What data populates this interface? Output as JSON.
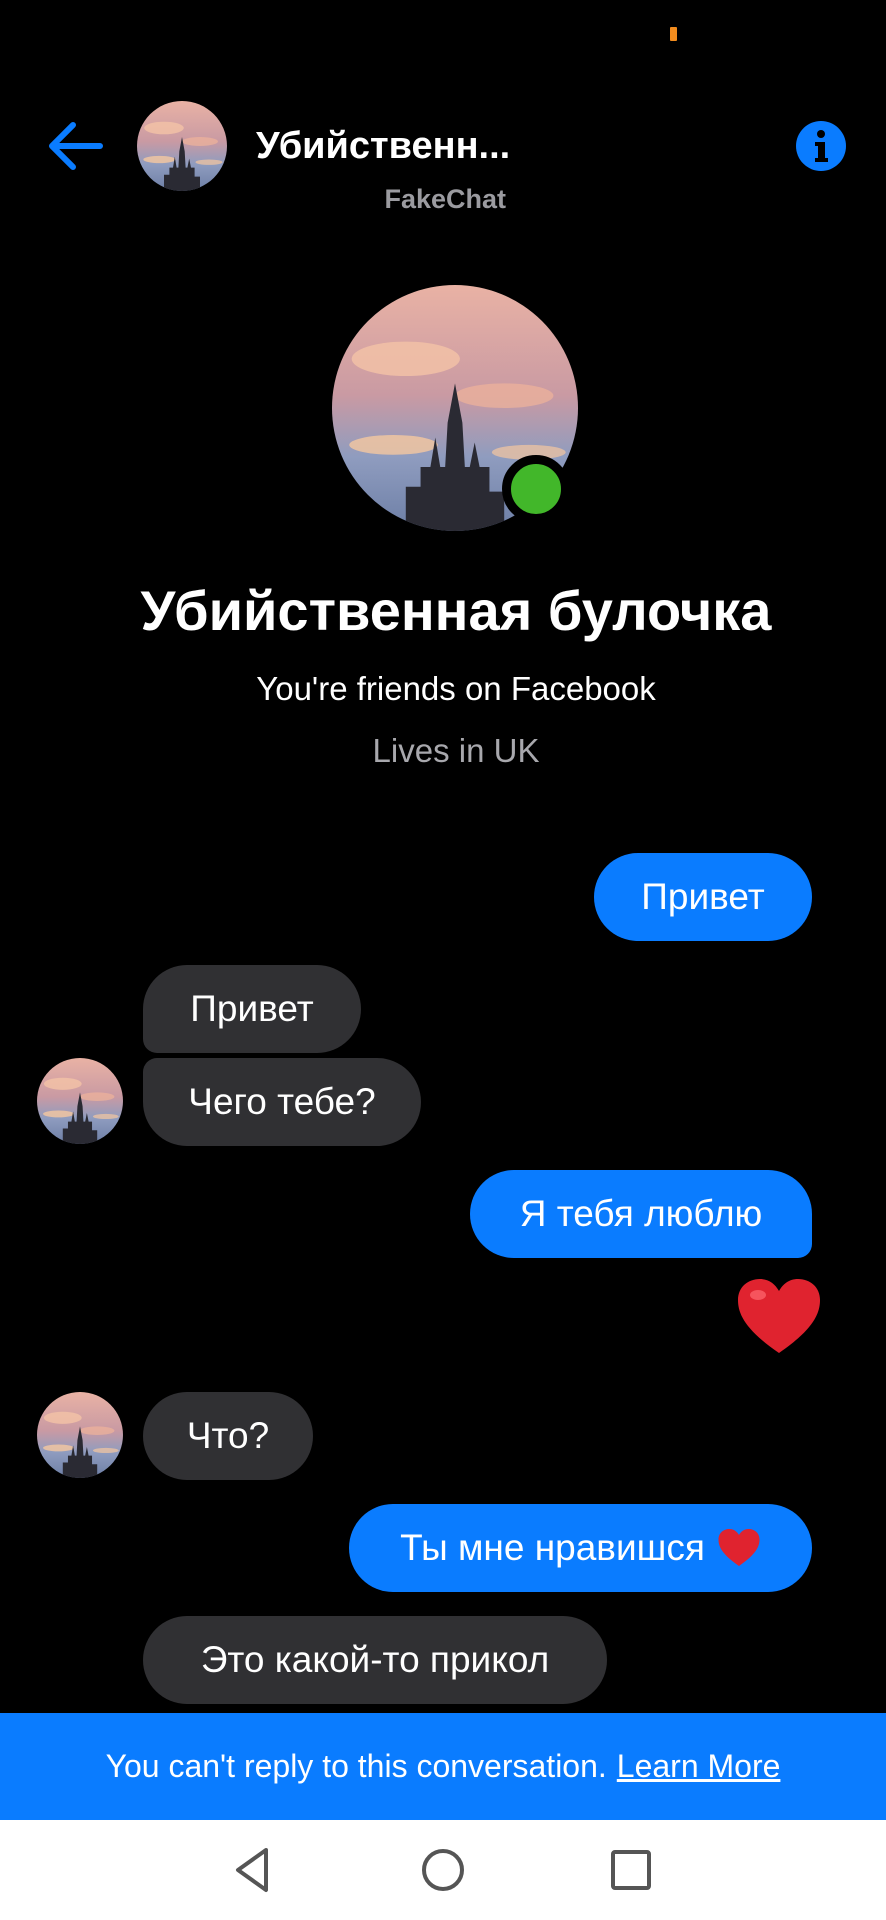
{
  "header": {
    "title": "Убийственн...",
    "subtitle": "FakeChat"
  },
  "profile": {
    "name": "Убийственная булочка",
    "friends_line": "You're friends on Facebook",
    "lives_line": "Lives in UK"
  },
  "messages": [
    {
      "direction": "outgoing",
      "text": "Привет"
    },
    {
      "direction": "incoming",
      "text": "Привет"
    },
    {
      "direction": "incoming",
      "text": "Чего тебе?"
    },
    {
      "direction": "outgoing",
      "text": "Я тебя люблю"
    },
    {
      "direction": "outgoing",
      "text": "❤️",
      "kind": "large-emoji"
    },
    {
      "direction": "incoming",
      "text": "Что?"
    },
    {
      "direction": "outgoing",
      "text": "Ты мне нравишся",
      "emoji": "heart"
    },
    {
      "direction": "incoming",
      "text": "Это какой-то прикол"
    }
  ],
  "banner": {
    "text": "You can't reply to this conversation.",
    "link": "Learn More"
  },
  "colors": {
    "accent": "#0a7cff",
    "incoming_bubble": "#303033",
    "online": "#42b72a",
    "background": "#000000"
  },
  "icons": [
    "back-arrow-icon",
    "info-icon",
    "heart-icon",
    "nav-back-icon",
    "nav-home-icon",
    "nav-recents-icon"
  ]
}
